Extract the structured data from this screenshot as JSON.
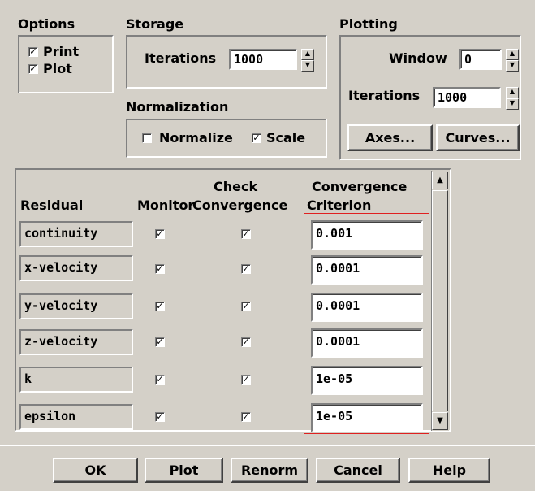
{
  "options": {
    "title": "Options",
    "print": {
      "label": "Print",
      "checked": true
    },
    "plot": {
      "label": "Plot",
      "checked": true
    }
  },
  "storage": {
    "title": "Storage",
    "iterations_label": "Iterations",
    "iterations_value": "1000"
  },
  "normalization": {
    "title": "Normalization",
    "normalize": {
      "label": "Normalize",
      "checked": false
    },
    "scale": {
      "label": "Scale",
      "checked": true
    }
  },
  "plotting": {
    "title": "Plotting",
    "window_label": "Window",
    "window_value": "0",
    "iterations_label": "Iterations",
    "iterations_value": "1000",
    "axes_label": "Axes...",
    "curves_label": "Curves..."
  },
  "table": {
    "headers": {
      "residual": "Residual",
      "monitor": "Monitor",
      "check_line1": "Check",
      "check_line2": "Convergence",
      "crit_line1": "Convergence",
      "crit_line2": "Criterion"
    },
    "rows": [
      {
        "name": "continuity",
        "monitor": true,
        "check": true,
        "criterion": "0.001"
      },
      {
        "name": "x-velocity",
        "monitor": true,
        "check": true,
        "criterion": "0.0001"
      },
      {
        "name": "y-velocity",
        "monitor": true,
        "check": true,
        "criterion": "0.0001"
      },
      {
        "name": "z-velocity",
        "monitor": true,
        "check": true,
        "criterion": "0.0001"
      },
      {
        "name": "k",
        "monitor": true,
        "check": true,
        "criterion": "1e-05"
      },
      {
        "name": "epsilon",
        "monitor": true,
        "check": true,
        "criterion": "1e-05"
      }
    ],
    "highlight_color": "#e02020"
  },
  "buttons": {
    "ok": "OK",
    "plot": "Plot",
    "renorm": "Renorm",
    "cancel": "Cancel",
    "help": "Help"
  }
}
